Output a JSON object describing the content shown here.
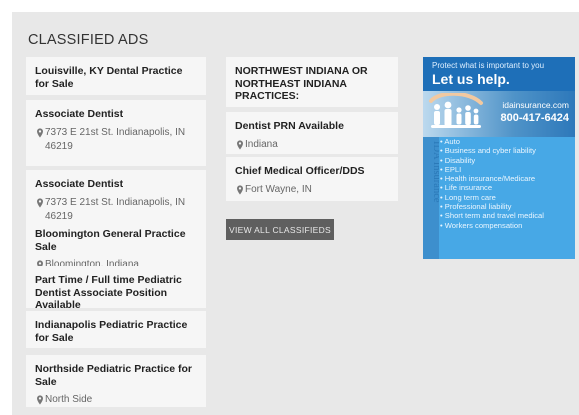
{
  "section": {
    "title": "CLASSIFIED ADS"
  },
  "column_left": [
    {
      "title": "Louisville, KY Dental Practice for Sale",
      "location": ""
    },
    {
      "title": "Associate Dentist",
      "location": "7373 E 21st St. Indianapolis, IN 46219"
    },
    {
      "title": "Associate Dentist",
      "location": "7373 E 21st St. Indianapolis, IN 46219"
    },
    {
      "title": "Bloomington General Practice Sale",
      "location": "Bloomington, Indiana"
    },
    {
      "title": "Part Time / Full time Pediatric Dentist Associate Position Available",
      "location": ""
    },
    {
      "title": "Indianapolis Pediatric Practice for Sale",
      "location": ""
    },
    {
      "title": "Northside Pediatric Practice for Sale",
      "location": "North Side"
    }
  ],
  "column_middle": [
    {
      "title": "NORTHWEST INDIANA OR NORTHEAST INDIANA PRACTICES:",
      "location": ""
    },
    {
      "title": "Dentist PRN Available",
      "location": "Indiana"
    },
    {
      "title": "Chief Medical Officer/DDS",
      "location": "Fort Wayne, IN"
    }
  ],
  "view_all_button": {
    "label": "VIEW ALL CLASSIFIEDS"
  },
  "ad": {
    "tagline": "Protect what is important to you",
    "headline": "Let us help.",
    "website": "idainsurance.com",
    "phone": "800-417-6424",
    "vertical_brand": "IDA Insurance",
    "items": [
      "Auto",
      "Business and cyber liability",
      "Disability",
      "EPLI",
      "Health insurance/Medicare",
      "Life insurance",
      "Long term care",
      "Professional liability",
      "Short term and travel medical",
      "Workers compensation"
    ],
    "colors": {
      "top": "#1e6fb8",
      "body": "#47a8e6"
    }
  },
  "icons": {
    "location": "map-pin-icon",
    "family": "paper-family-icon"
  }
}
